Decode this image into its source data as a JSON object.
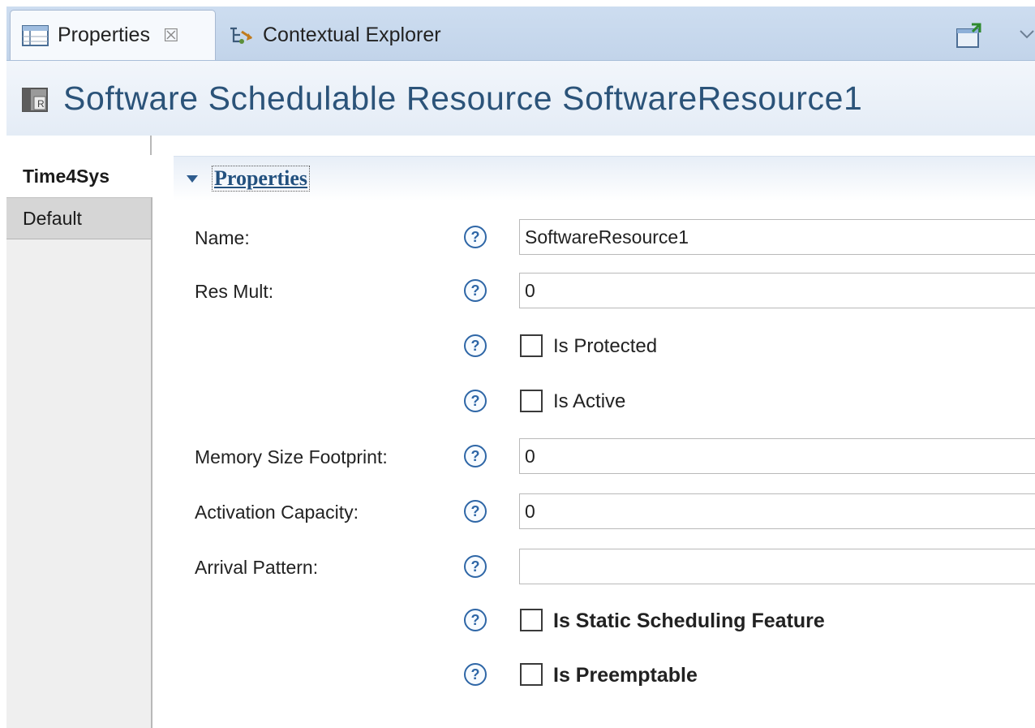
{
  "tabs": [
    {
      "label": "Properties",
      "icon": "properties-view-icon",
      "close": "☒",
      "active": true
    },
    {
      "label": "Contextual Explorer",
      "icon": "contextual-explorer-icon",
      "active": false
    }
  ],
  "toolbar": {
    "icons": [
      "new-window-icon",
      "view-menu-icon"
    ]
  },
  "header": {
    "icon": "resource-icon",
    "title": "Software Schedulable Resource SoftwareResource1"
  },
  "side_tabs": [
    {
      "label": "Time4Sys",
      "active": true
    },
    {
      "label": "Default",
      "active": false
    }
  ],
  "section": {
    "title": "Properties",
    "expanded": true
  },
  "help_glyph": "?",
  "fields": {
    "name": {
      "label": "Name:",
      "value": "SoftwareResource1"
    },
    "res_mult": {
      "label": "Res Mult:",
      "value": "0"
    },
    "is_protected": {
      "label": "Is Protected",
      "checked": false
    },
    "is_active": {
      "label": "Is Active",
      "checked": false
    },
    "memory_size_footprint": {
      "label": "Memory Size Footprint:",
      "value": "0"
    },
    "activation_capacity": {
      "label": "Activation Capacity:",
      "value": "0"
    },
    "arrival_pattern": {
      "label": "Arrival Pattern:",
      "value": ""
    },
    "is_static_scheduling_feature": {
      "label": "Is Static Scheduling Feature",
      "checked": false
    },
    "is_preemptable": {
      "label": "Is Preemptable",
      "checked": false
    }
  }
}
